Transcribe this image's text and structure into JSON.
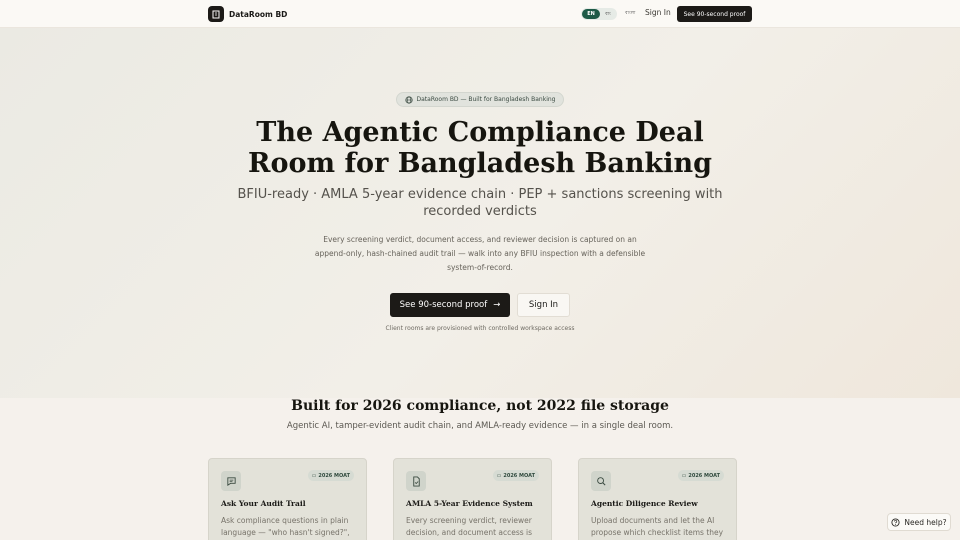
{
  "header": {
    "brand": "DataRoom BD",
    "lang_en": "EN",
    "lang_bn_small": "বাং",
    "lang_bn": "বাংলা",
    "signin": "Sign In",
    "cta": "See 90-second proof"
  },
  "hero": {
    "badge": "DataRoom BD — Built for Bangladesh Banking",
    "title": "The Agentic Compliance Deal Room for Bangladesh Banking",
    "subtitle": "BFIU-ready · AMLA 5-year evidence chain · PEP + sanctions screening with recorded verdicts",
    "description": "Every screening verdict, document access, and reviewer decision is captured on an append-only, hash-chained audit trail — walk into any BFIU inspection with a defensible system-of-record.",
    "primary_button": "See 90-second proof",
    "secondary_button": "Sign In",
    "note": "Client rooms are provisioned with controlled workspace access"
  },
  "section": {
    "title": "Built for 2026 compliance, not 2022 file storage",
    "subtitle": "Agentic AI, tamper-evident audit chain, and AMLA-ready evidence — in a single deal room."
  },
  "cards": [
    {
      "icon": "message-icon",
      "moat": "2026 MOAT",
      "title": "Ask Your Audit Trail",
      "text": "Ask compliance questions in plain language — \"who hasn't signed?\", \"every"
    },
    {
      "icon": "document-check-icon",
      "moat": "2026 MOAT",
      "title": "AMLA 5-Year Evidence System",
      "text": "Every screening verdict, reviewer decision, and document access is"
    },
    {
      "icon": "search-icon",
      "moat": "2026 MOAT",
      "title": "Agentic Diligence Review",
      "text": "Upload documents and let the AI propose which checklist items they satisfy — with"
    }
  ],
  "help": "Need help?",
  "colors": {
    "primary_dark": "#1c1a17",
    "accent_green": "#1d5a46",
    "background": "#f6f2ec"
  }
}
